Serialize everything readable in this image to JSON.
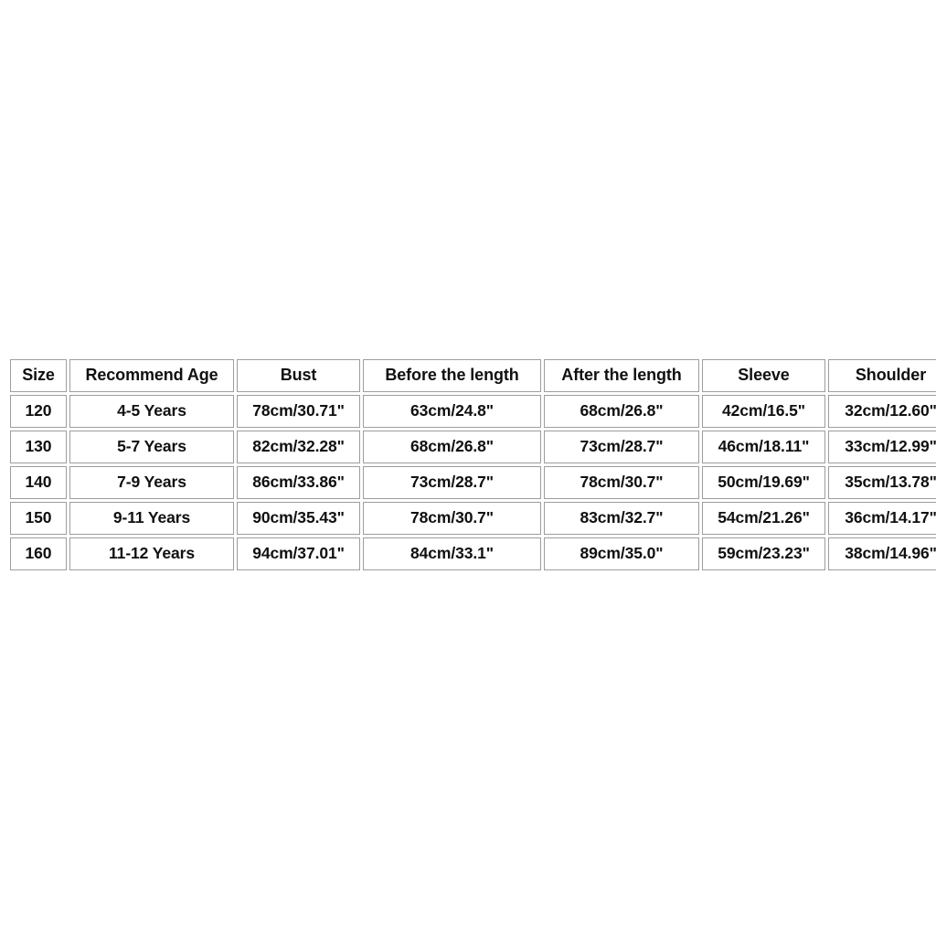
{
  "chart_data": {
    "type": "table",
    "title": "",
    "columns": [
      "Size",
      "Recommend Age",
      "Bust",
      "Before the length",
      "After the length",
      "Sleeve",
      "Shoulder"
    ],
    "rows": [
      [
        "120",
        "4-5 Years",
        "78cm/30.71\"",
        "63cm/24.8\"",
        "68cm/26.8\"",
        "42cm/16.5\"",
        "32cm/12.60\""
      ],
      [
        "130",
        "5-7 Years",
        "82cm/32.28\"",
        "68cm/26.8\"",
        "73cm/28.7\"",
        "46cm/18.11\"",
        "33cm/12.99\""
      ],
      [
        "140",
        "7-9 Years",
        "86cm/33.86\"",
        "73cm/28.7\"",
        "78cm/30.7\"",
        "50cm/19.69\"",
        "35cm/13.78\""
      ],
      [
        "150",
        "9-11 Years",
        "90cm/35.43\"",
        "78cm/30.7\"",
        "83cm/32.7\"",
        "54cm/21.26\"",
        "36cm/14.17\""
      ],
      [
        "160",
        "11-12 Years",
        "94cm/37.01\"",
        "84cm/33.1\"",
        "89cm/35.0\"",
        "59cm/23.23\"",
        "38cm/14.96\""
      ]
    ],
    "colors": {
      "page_background": "#ffffff",
      "cell_background": "#ffffff",
      "cell_border": "#9d9d9d",
      "text": "#101010"
    }
  }
}
